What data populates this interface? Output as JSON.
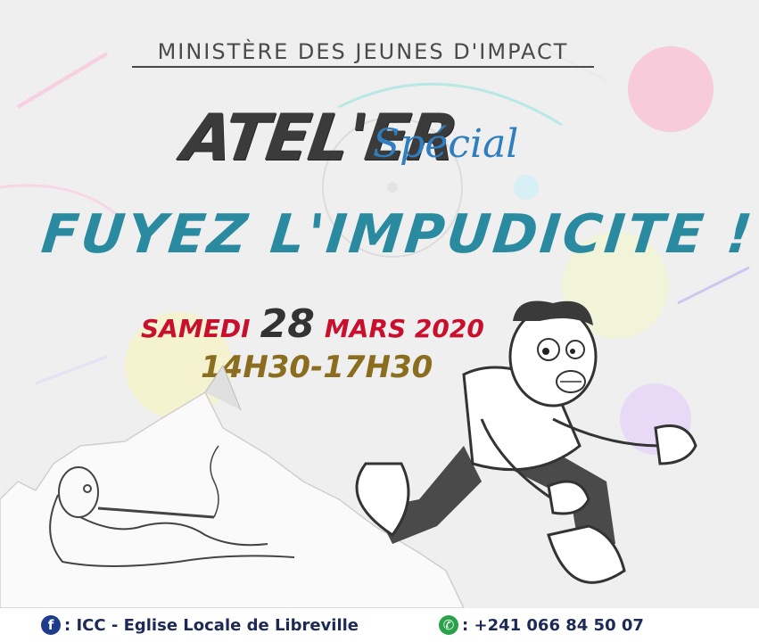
{
  "header": {
    "ministry": "MINISTÈRE DES JEUNES D'IMPACT"
  },
  "title": {
    "atelier": "ATEL'ER",
    "special": "Spécial"
  },
  "headline": "FUYEZ L'IMPUDICITE !",
  "date": {
    "weekday": "SAMEDI",
    "day": "28",
    "month_year": "MARS 2020"
  },
  "hours": "14H30-17H30",
  "footer": {
    "facebook_text": ": ICC - Eglise Locale de Libreville",
    "whatsapp_text": ": +241 066 84 50 07"
  },
  "colors": {
    "headline": "#2a8aa0",
    "date_red": "#c8102e",
    "hours": "#8a6d1e",
    "special": "#2f7fc0",
    "footer_text": "#1c2a55"
  },
  "icons": [
    "facebook-icon",
    "whatsapp-icon"
  ]
}
